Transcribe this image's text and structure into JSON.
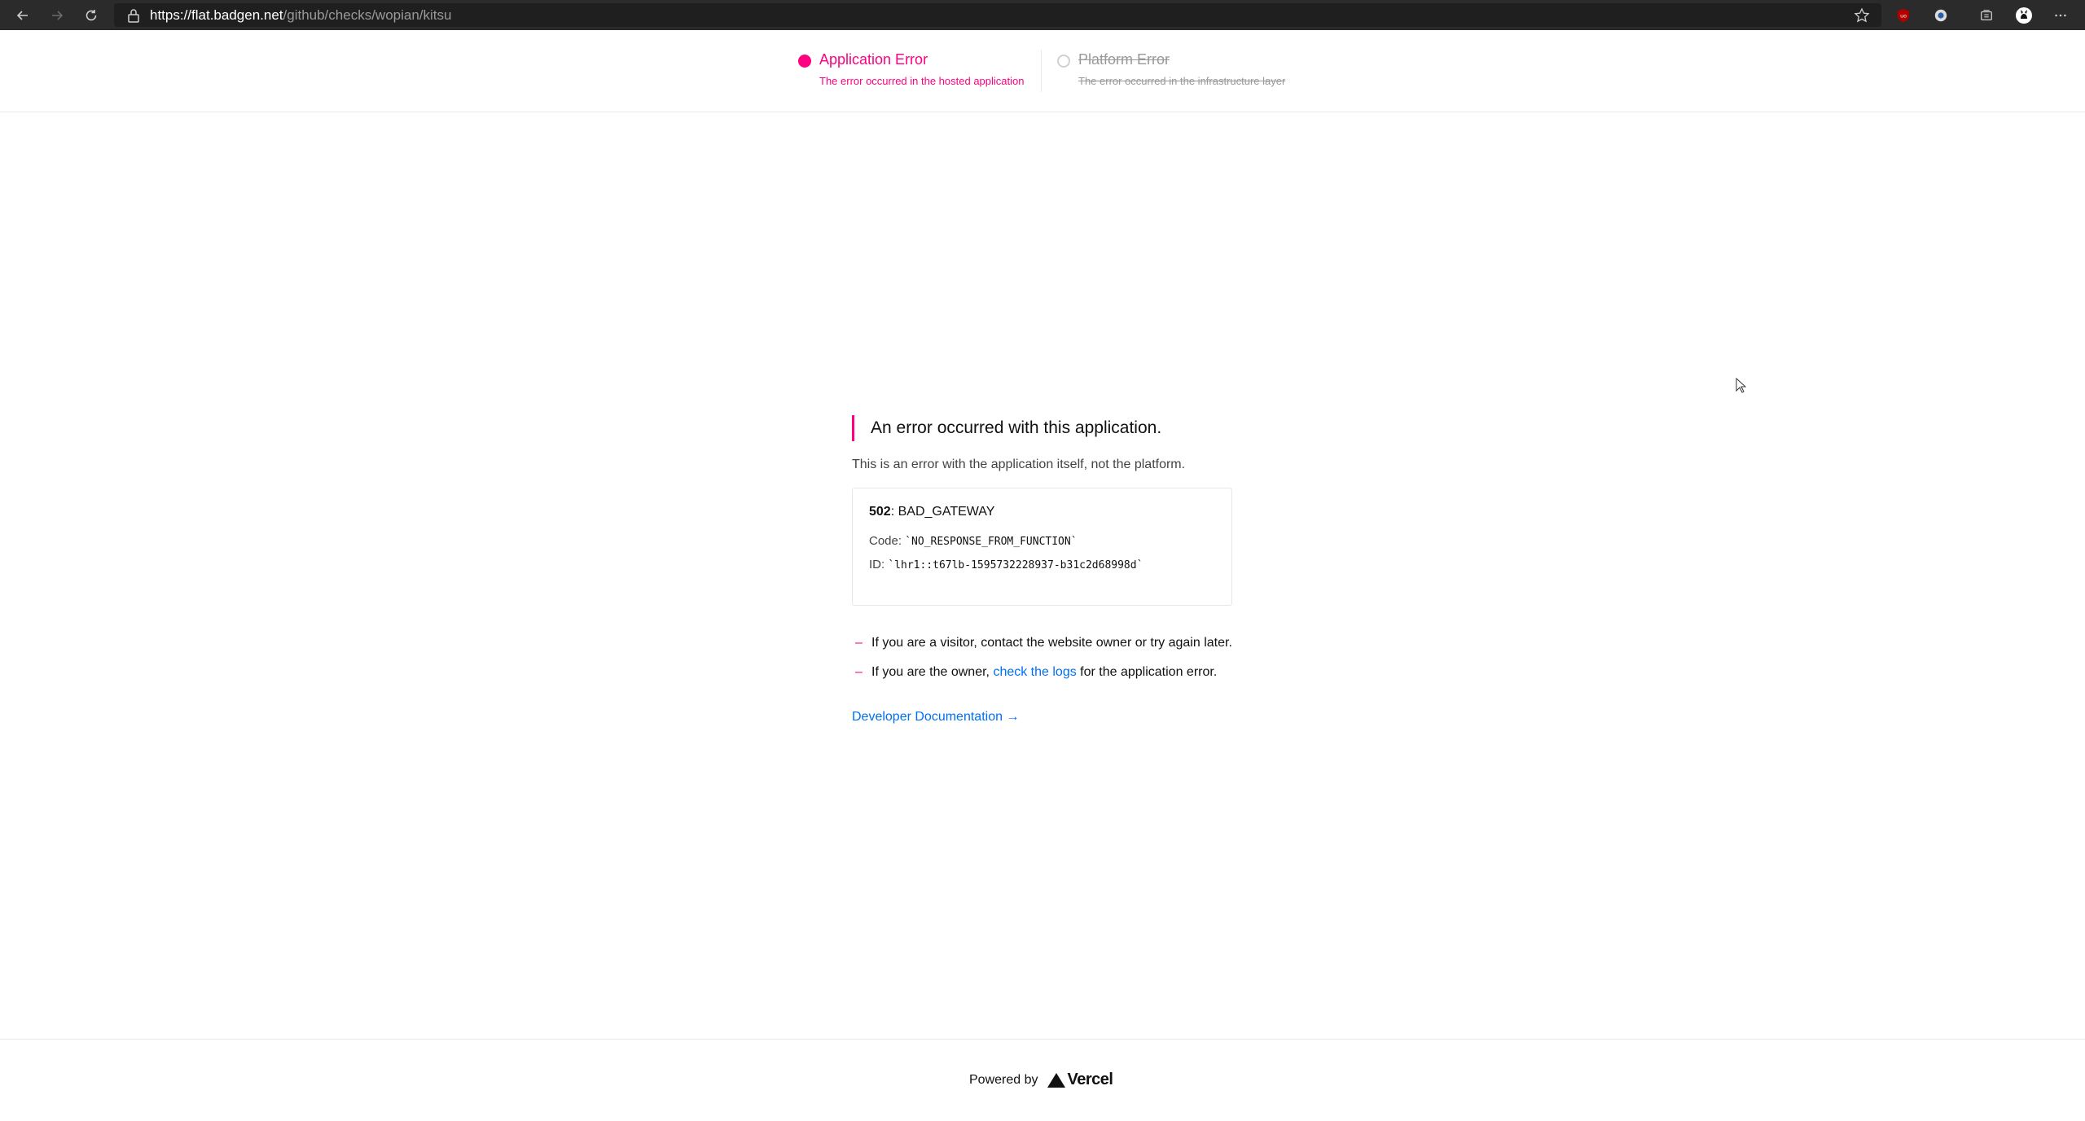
{
  "browser": {
    "url_host": "https://flat.badgen.net",
    "url_path": "/github/checks/wopian/kitsu",
    "icons": [
      "back-arrow-icon",
      "forward-arrow-icon",
      "reload-icon",
      "lock-icon",
      "star-icon",
      "ublock-icon",
      "extension-icon",
      "collections-icon",
      "profile-icon",
      "more-icon"
    ]
  },
  "status": {
    "application": {
      "title": "Application Error",
      "subtitle": "The error occurred in the hosted application"
    },
    "platform": {
      "title": "Platform Error",
      "subtitle": "The error occurred in the infrastructure layer"
    }
  },
  "main": {
    "heading": "An error occurred with this application.",
    "description": "This is an error with the application itself, not the platform.",
    "error": {
      "status_code": "502",
      "status_text": ": BAD_GATEWAY",
      "code_label": "Code:",
      "code_value": "`NO_RESPONSE_FROM_FUNCTION`",
      "id_label": "ID:",
      "id_value": "`lhr1::t67lb-1595732228937-b31c2d68998d`"
    },
    "bullets": {
      "visitor": "If you are a visitor, contact the website owner or try again later.",
      "owner_prefix": "If you are the owner,",
      "owner_link": "check the logs",
      "owner_suffix": "for the application error."
    },
    "dev_docs": "Developer Documentation →"
  },
  "footer": {
    "powered_by": "Powered by",
    "brand": "Vercel"
  },
  "colors": {
    "accent": "#ff0080",
    "link": "#0070f3",
    "chrome": "#2b2b2b"
  }
}
